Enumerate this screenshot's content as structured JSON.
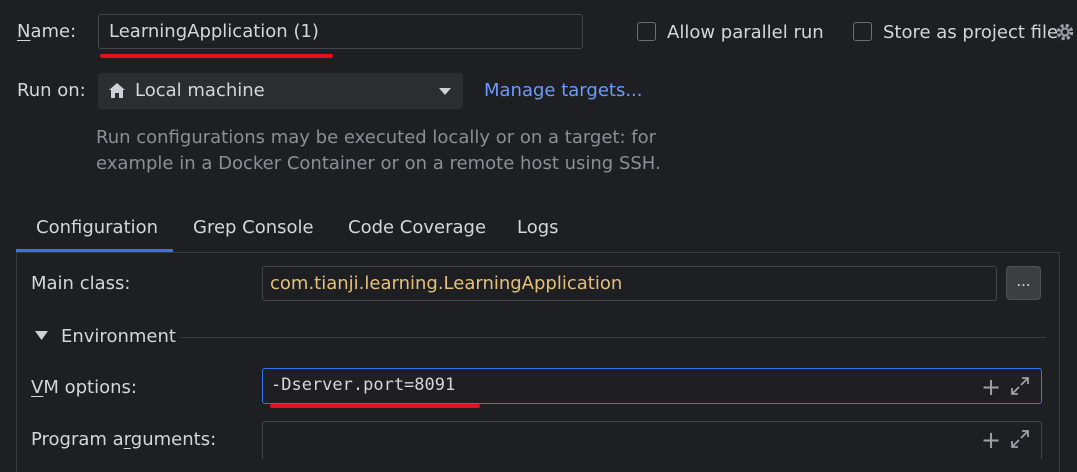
{
  "name": {
    "label": "Name:",
    "value": "LearningApplication (1)"
  },
  "options": {
    "allow_parallel": "Allow parallel run",
    "store_project": "Store as project file"
  },
  "run_on": {
    "label": "Run on:",
    "selected": "Local machine",
    "manage_link": "Manage targets...",
    "hint_line1": "Run configurations may be executed locally or on a target: for",
    "hint_line2": "example in a Docker Container or on a remote host using SSH."
  },
  "tabs": [
    {
      "label": "Configuration"
    },
    {
      "label": "Grep Console"
    },
    {
      "label": "Code Coverage"
    },
    {
      "label": "Logs"
    }
  ],
  "config": {
    "main_class_label": "Main class:",
    "main_class_value": "com.tianji.learning.LearningApplication",
    "browse_label": "...",
    "environment_label": "Environment",
    "vm_options_label": "VM options:",
    "vm_options_value": "-Dserver.port=8091",
    "program_args_label": "Program arguments:",
    "program_args_value": ""
  },
  "colors": {
    "background": "#1e1f22",
    "link": "#6b9bff",
    "main_class_text": "#e5c07b",
    "highlight_underline": "#e3121c",
    "focus_border": "#3574f0"
  }
}
